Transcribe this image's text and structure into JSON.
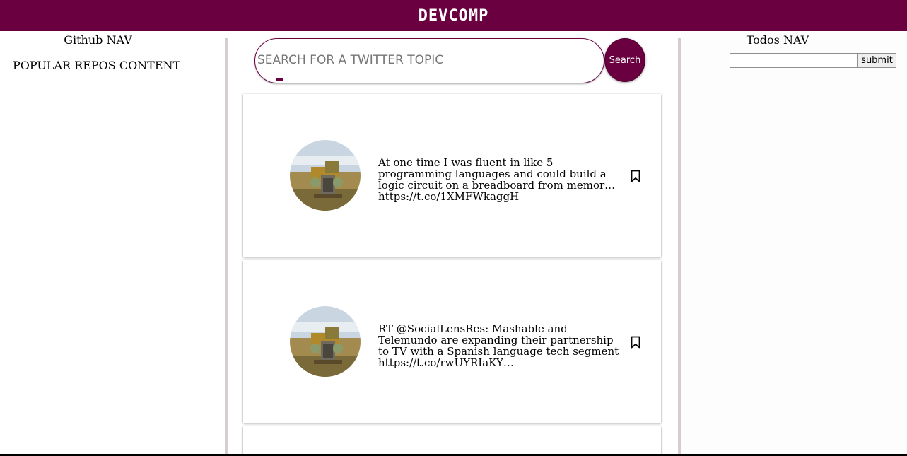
{
  "header": {
    "brand": "DEVCOMP"
  },
  "left_panel": {
    "title": "Github NAV",
    "content": "POPULAR REPOS CONTENT"
  },
  "search": {
    "placeholder": "SEARCH FOR A TWITTER TOPIC",
    "button_label": "Search"
  },
  "tweets": [
    {
      "text": "At one time I was fluent in like 5 programming languages and could build a logic circuit on a breadboard from memor… https://t.co/1XMFWkaggH",
      "avatar": "truck-avatar",
      "bookmark_icon": "bookmark-icon"
    },
    {
      "text": "RT @SocialLensRes: Mashable and Telemundo are expanding their partnership to TV with a Spanish language tech segment https://t.co/rwUYRIaKY…",
      "avatar": "truck-avatar",
      "bookmark_icon": "bookmark-icon"
    },
    {
      "text": ""
    }
  ],
  "right_panel": {
    "title": "Todos NAV",
    "input_value": "",
    "submit_label": "submit"
  },
  "colors": {
    "brand": "#6a003f",
    "divider": "#d6cdd0"
  }
}
